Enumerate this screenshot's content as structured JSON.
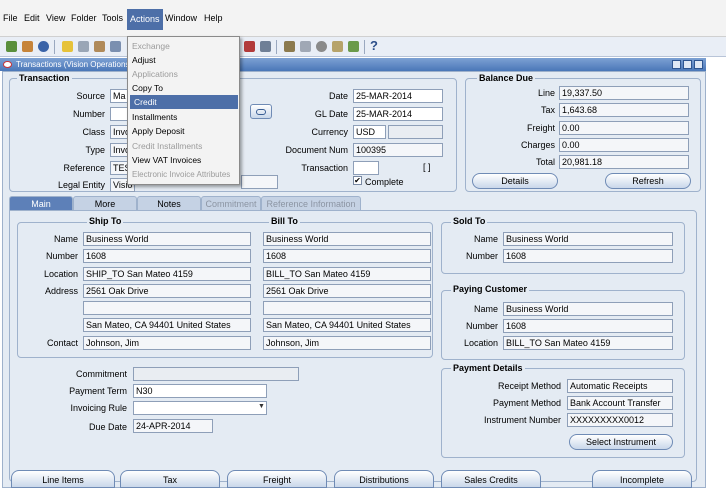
{
  "menubar": {
    "items": [
      "File",
      "Edit",
      "View",
      "Folder",
      "Tools",
      "Actions",
      "Window",
      "Help"
    ]
  },
  "actions_menu": {
    "items": [
      {
        "label": "Exchange",
        "enabled": false
      },
      {
        "label": "Adjust",
        "enabled": true
      },
      {
        "label": "Applications",
        "enabled": false
      },
      {
        "label": "Copy To",
        "enabled": true
      },
      {
        "label": "Credit",
        "enabled": true,
        "selected": true
      },
      {
        "label": "Installments",
        "enabled": true
      },
      {
        "label": "Apply Deposit",
        "enabled": true
      },
      {
        "label": "Credit Installments",
        "enabled": false
      },
      {
        "label": "View VAT Invoices",
        "enabled": true
      },
      {
        "label": "Electronic Invoice Attributes",
        "enabled": false
      }
    ]
  },
  "window": {
    "title": "Transactions (Vision Operations)"
  },
  "transaction": {
    "title": "Transaction",
    "labels": {
      "source": "Source",
      "number": "Number",
      "class": "Class",
      "type": "Type",
      "reference": "Reference",
      "legal_entity": "Legal Entity",
      "date": "Date",
      "gl_date": "GL Date",
      "currency": "Currency",
      "document_num": "Document Num",
      "transaction": "Transaction"
    },
    "source": "Ma",
    "number": "",
    "class": "Invo",
    "type": "Invo",
    "reference": "TES",
    "legal_entity": "Visio",
    "date": "25-MAR-2014",
    "gl_date": "25-MAR-2014",
    "currency": "USD",
    "document_num": "100395",
    "transaction_value": "",
    "transaction_bracket": "[  ]",
    "complete_label": "Complete",
    "complete_checked": true
  },
  "balance_due": {
    "title": "Balance Due",
    "labels": {
      "line": "Line",
      "tax": "Tax",
      "freight": "Freight",
      "charges": "Charges",
      "total": "Total"
    },
    "line": "19,337.50",
    "tax": "1,643.68",
    "freight": "0.00",
    "charges": "0.00",
    "total": "20,981.18",
    "details_button": "Details",
    "refresh_button": "Refresh"
  },
  "tabs": [
    {
      "label": "Main",
      "state": "active"
    },
    {
      "label": "More",
      "state": "normal"
    },
    {
      "label": "Notes",
      "state": "normal"
    },
    {
      "label": "Commitment",
      "state": "disabled"
    },
    {
      "label": "Reference Information",
      "state": "disabled"
    }
  ],
  "ship_to": {
    "title": "Ship To",
    "name": "Business World",
    "number": "1608",
    "location": "SHIP_TO San Mateo 4159",
    "address1": "2561 Oak Drive",
    "address2": "",
    "address3": "",
    "city_line": "San Mateo, CA 94401 United States",
    "contact": "Johnson, Jim"
  },
  "bill_to": {
    "title": "Bill To",
    "name": "Business World",
    "number": "1608",
    "location": "BILL_TO San Mateo 4159",
    "address1": "2561 Oak Drive",
    "address2": "",
    "address3": "",
    "city_line": "San Mateo, CA 94401 United States",
    "contact": "Johnson, Jim"
  },
  "address_labels": {
    "name": "Name",
    "number": "Number",
    "location": "Location",
    "address": "Address",
    "contact": "Contact"
  },
  "sold_to": {
    "title": "Sold To",
    "name_label": "Name",
    "number_label": "Number",
    "name": "Business World",
    "number": "1608"
  },
  "paying_customer": {
    "title": "Paying Customer",
    "name_label": "Name",
    "number_label": "Number",
    "location_label": "Location",
    "name": "Business World",
    "number": "1608",
    "location": "BILL_TO San Mateo 4159"
  },
  "terms": {
    "commitment_label": "Commitment",
    "payment_term_label": "Payment Term",
    "invoicing_rule_label": "Invoicing Rule",
    "due_date_label": "Due Date",
    "commitment": "",
    "payment_term": "N30",
    "invoicing_rule": "",
    "due_date": "24-APR-2014"
  },
  "payment_details": {
    "title": "Payment Details",
    "receipt_method_label": "Receipt Method",
    "payment_method_label": "Payment Method",
    "instrument_number_label": "Instrument Number",
    "receipt_method": "Automatic Receipts",
    "payment_method": "Bank Account Transfer",
    "instrument_number": "XXXXXXXXX0012",
    "select_instrument_button": "Select Instrument"
  },
  "bottom_buttons": [
    "Line Items",
    "Tax",
    "Freight",
    "Distributions",
    "Sales Credits",
    "Incomplete"
  ]
}
